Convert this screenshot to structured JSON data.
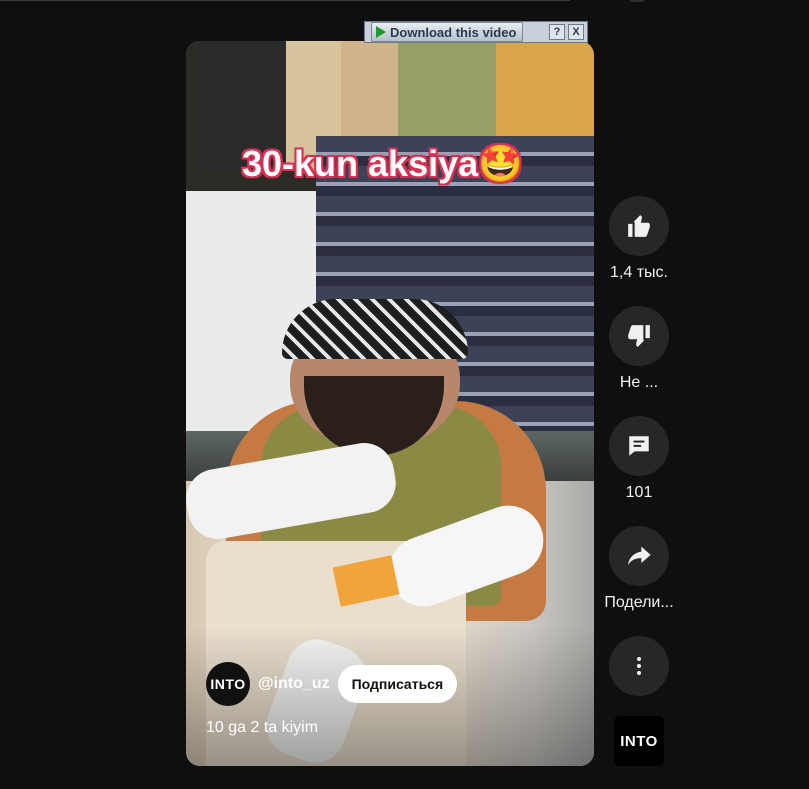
{
  "video": {
    "overlay_text": "30-kun aksiya🤩",
    "channel": {
      "avatar_text": "INTO",
      "handle": "@into_uz",
      "subscribe_label": "Подписаться"
    },
    "caption": "10 ga 2 ta kiyim"
  },
  "download_bar": {
    "label": "Download this video",
    "help_label": "?",
    "close_label": "X"
  },
  "actions": {
    "like": {
      "icon": "thumbs-up-icon",
      "label": "1,4 тыс."
    },
    "dislike": {
      "icon": "thumbs-down-icon",
      "label": "Не ..."
    },
    "comments": {
      "icon": "comment-icon",
      "label": "101"
    },
    "share": {
      "icon": "share-icon",
      "label": "Подели..."
    },
    "more": {
      "icon": "more-vertical-icon"
    }
  },
  "channel_thumb": {
    "text": "INTO"
  },
  "colors": {
    "background": "#0f0f0f",
    "action_button": "#272727",
    "subscribe_button": "#ffffff",
    "overlay_text_outline": "#d63355"
  }
}
